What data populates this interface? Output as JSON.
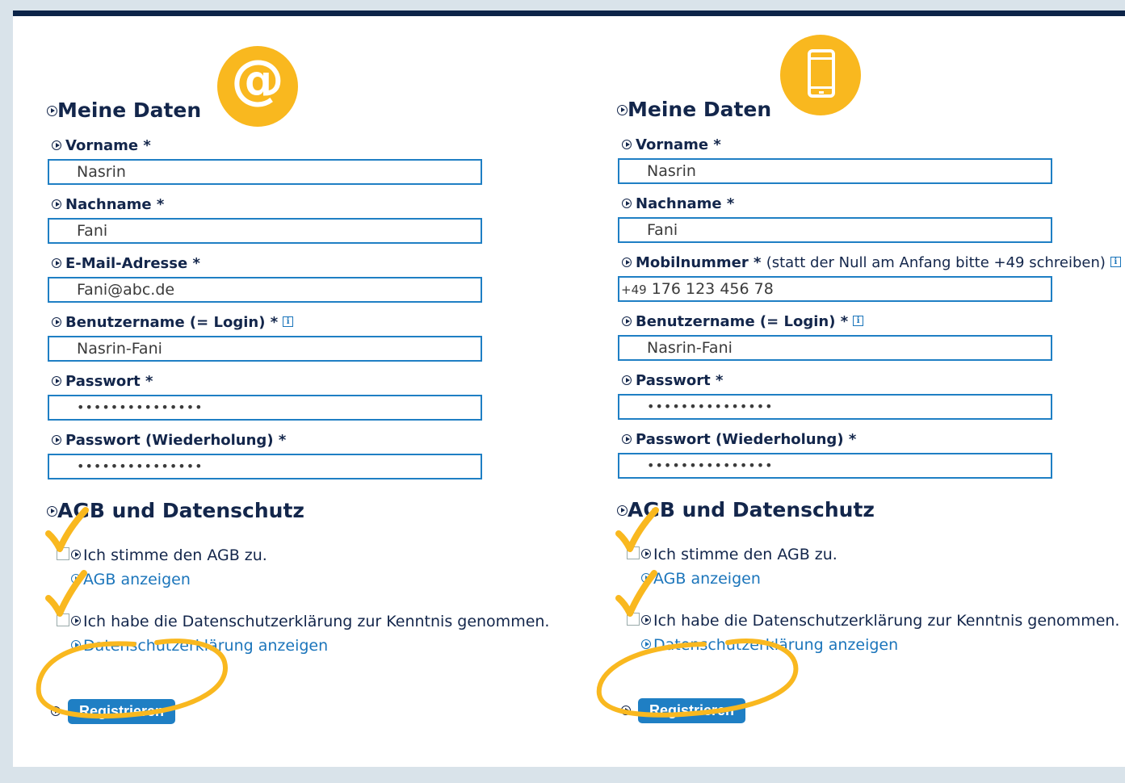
{
  "forms": [
    {
      "badge": "@",
      "badge_icon": "at-icon",
      "section_title": "Meine Daten",
      "fields": [
        {
          "label": "Vorname *",
          "value": "Nasrin"
        },
        {
          "label": "Nachname *",
          "value": "Fani"
        },
        {
          "label": "E-Mail-Adresse *",
          "value": "Fani@abc.de"
        },
        {
          "label": "Benutzername (= Login) *",
          "value": "Nasrin-Fani"
        },
        {
          "label": "Passwort *",
          "value": "•••••••••••••••"
        },
        {
          "label": "Passwort (Wiederholung) *",
          "value": "•••••••••••••••"
        }
      ],
      "agb_title": "AGB und Datenschutz",
      "agb_checkbox": "Ich stimme den AGB zu.",
      "agb_link": "AGB anzeigen",
      "privacy_checkbox": "Ich habe die Datenschutzerklärung zur Kenntnis genommen.",
      "privacy_link": "Datenschutzerklärung anzeigen",
      "register_button": "Registrieren"
    },
    {
      "badge_icon": "smartphone-icon",
      "section_title": "Meine Daten",
      "fields": [
        {
          "label": "Vorname *",
          "value": "Nasrin"
        },
        {
          "label": "Nachname *",
          "value": "Fani"
        },
        {
          "label": "Mobilnummer *",
          "note": "(statt der Null am Anfang bitte +49 schreiben)",
          "value_prefix": "+49",
          "value": "176 123 456 78"
        },
        {
          "label": "Benutzername (= Login) *",
          "value": "Nasrin-Fani"
        },
        {
          "label": "Passwort *",
          "value": "•••••••••••••••"
        },
        {
          "label": "Passwort (Wiederholung) *",
          "value": "•••••••••••••••"
        }
      ],
      "agb_title": "AGB und Datenschutz",
      "agb_checkbox": "Ich stimme den AGB zu.",
      "agb_link": "AGB anzeigen",
      "privacy_checkbox": "Ich habe die Datenschutzerklärung zur Kenntnis genommen.",
      "privacy_link": "Datenschutzerklärung anzeigen",
      "register_button": "Registrieren"
    }
  ],
  "colors": {
    "accent": "#1f7fc4",
    "navy": "#13264b",
    "highlight": "#f9b81f",
    "background": "#d9e3ea"
  }
}
